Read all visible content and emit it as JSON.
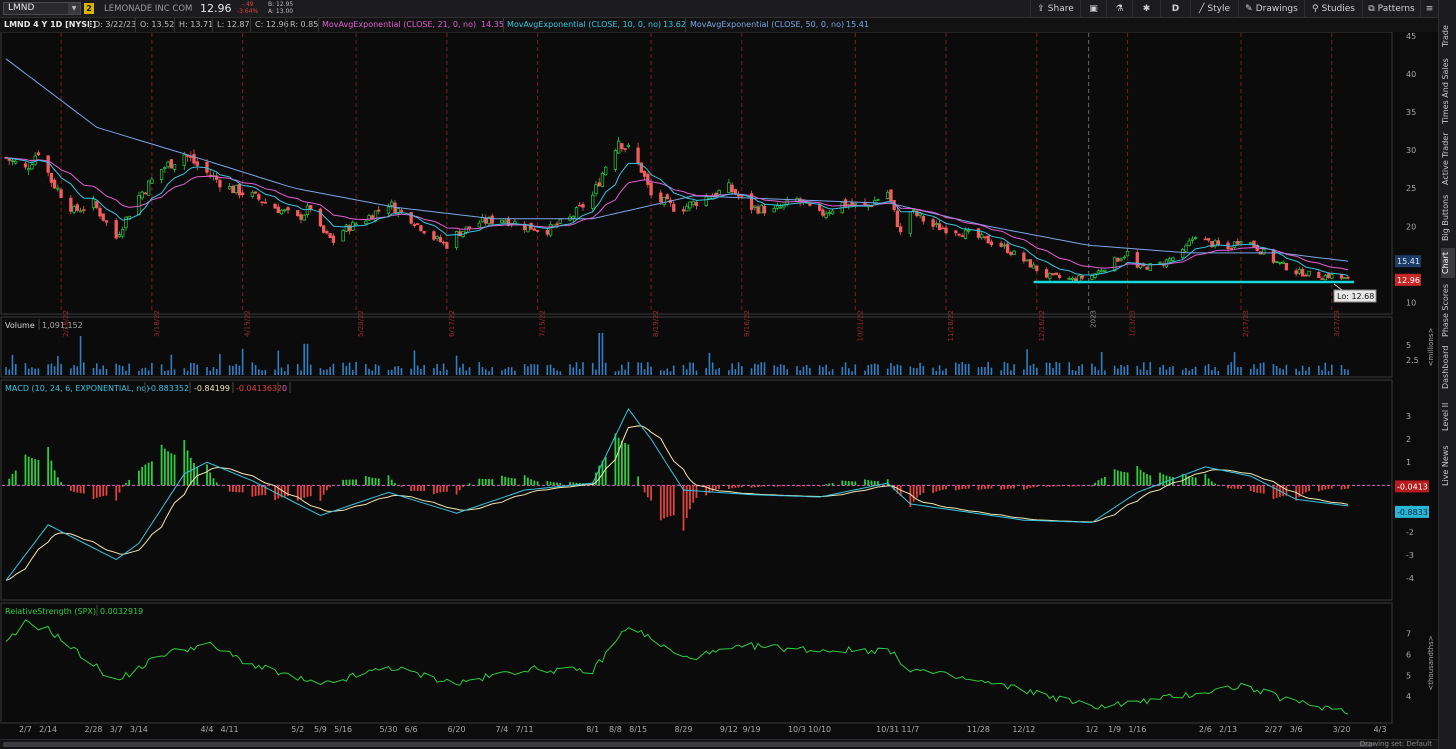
{
  "toolbar": {
    "symbol": "LMND",
    "link_number": "2",
    "company": "LEMONADE INC COM",
    "last_price": "12.96",
    "change": "-.49",
    "change_pct": "-3.64%",
    "bid": "B: 12.95",
    "ask": "A: 13.00",
    "buttons": {
      "share": "Share",
      "period": "D",
      "style": "Style",
      "drawings": "Drawings",
      "studies": "Studies",
      "patterns": "Patterns"
    },
    "icons": [
      "share-icon",
      "grid-icon",
      "flask-icon",
      "gear-icon",
      "style-icon",
      "pencil-icon",
      "studies-icon",
      "patterns-icon",
      "menu-icon"
    ]
  },
  "infobar": {
    "title": "LMND 4 Y 1D [NYSE]",
    "date": "D: 3/22/23",
    "open": "O: 13.52",
    "high": "H: 13.71",
    "low": "L: 12.87",
    "close": "C: 12.96",
    "range": "R: 0.85",
    "ma1_label": "MovAvgExponential (CLOSE, 21, 0, no)",
    "ma1_value": "14.35",
    "ma2_label": "MovAvgExponential (CLOSE, 10, 0, no)",
    "ma2_value": "13.62",
    "ma3_label": "MovAvgExponential (CLOSE, 50, 0, no)",
    "ma3_value": "15.41"
  },
  "price_panel": {
    "y_ticks": [
      "45",
      "40",
      "35",
      "30",
      "25",
      "20",
      "10"
    ],
    "low_label": "Lo: 12.68",
    "last_badge": "12.96",
    "ma50_badge": "15.41",
    "marker_dates": [
      "2/18/22",
      "3/18/22",
      "4/15/22",
      "5/20/22",
      "6/17/22",
      "7/15/22",
      "8/19/22",
      "9/16/22",
      "10/21/22",
      "11/18/22",
      "12/16/22",
      "2023",
      "1/13/23",
      "2/17/23",
      "3/17/23"
    ],
    "colors": {
      "up": "#2ecc40",
      "down": "#f25c5c",
      "ema21": "#e05fd4",
      "ema10": "#36c4e0",
      "ema50": "#7aa6e8",
      "support": "#16d8d8"
    }
  },
  "volume_panel": {
    "title": "Volume",
    "value": "1,091,152",
    "y_ticks": [
      "5",
      "2.5"
    ],
    "unit": "<millions>"
  },
  "macd_panel": {
    "title": "MACD (10, 24, 6, EXPONENTIAL, no)",
    "value": "-0.883352",
    "avg": "-0.84199",
    "diff": "-0.0413632",
    "zero": "0",
    "y_ticks": [
      "3",
      "2",
      "1",
      "-1",
      "-2",
      "-3",
      "-4"
    ],
    "badge_diff": "-0.0413",
    "badge_value": "-0.8833"
  },
  "rs_panel": {
    "title": "RelativeStrength (SPX)",
    "value": "0.0032919",
    "y_ticks": [
      "7",
      "6",
      "5",
      "4"
    ],
    "unit": "<thousandths>"
  },
  "x_axis": {
    "labels": [
      "2/7",
      "2/14",
      "2/28",
      "3/7",
      "3/14",
      "4/4",
      "4/11",
      "5/2",
      "5/9",
      "5/16",
      "5/30",
      "6/6",
      "6/20",
      "7/4",
      "7/11",
      "8/1",
      "8/8",
      "8/15",
      "8/29",
      "9/12",
      "9/19",
      "10/3",
      "10/10",
      "10/31",
      "11/7",
      "11/28",
      "12/12",
      "1/2",
      "1/9",
      "1/16",
      "2/6",
      "2/13",
      "2/27",
      "3/6",
      "3/20",
      "4/3"
    ]
  },
  "side_tabs": [
    "Trade",
    "Times And Sales",
    "Active Trader",
    "Big Buttons",
    "Chart",
    "Phase Scores",
    "Dashboard",
    "Level II",
    "Live News"
  ],
  "footer": {
    "drawing_set": "Drawing set: Default"
  },
  "chart_data": {
    "type": "candlestick",
    "symbol": "LMND",
    "interval": "1D",
    "x_start": "2/1/22",
    "x_end": "3/22/23",
    "ylim": [
      9,
      45
    ],
    "close_path": [
      [
        "2/1/22",
        29
      ],
      [
        "2/7/22",
        27.5
      ],
      [
        "2/11/22",
        30
      ],
      [
        "2/15/22",
        26
      ],
      [
        "2/22/22",
        22
      ],
      [
        "2/28/22",
        23
      ],
      [
        "3/7/22",
        18.5
      ],
      [
        "3/10/22",
        21
      ],
      [
        "3/14/22",
        24
      ],
      [
        "3/21/22",
        27.5
      ],
      [
        "3/28/22",
        29.5
      ],
      [
        "4/1/22",
        28
      ],
      [
        "4/4/22",
        27
      ],
      [
        "4/11/22",
        25
      ],
      [
        "4/18/22",
        24
      ],
      [
        "4/25/22",
        22.5
      ],
      [
        "5/2/22",
        21
      ],
      [
        "5/6/22",
        22.5
      ],
      [
        "5/9/22",
        19.5
      ],
      [
        "5/13/22",
        18
      ],
      [
        "5/16/22",
        19.5
      ],
      [
        "5/23/22",
        21
      ],
      [
        "5/30/22",
        23
      ],
      [
        "6/6/22",
        21
      ],
      [
        "6/13/22",
        18.5
      ],
      [
        "6/17/22",
        17.5
      ],
      [
        "6/20/22",
        19
      ],
      [
        "6/27/22",
        20.5
      ],
      [
        "7/4/22",
        21
      ],
      [
        "7/11/22",
        20
      ],
      [
        "7/18/22",
        19.5
      ],
      [
        "7/25/22",
        21
      ],
      [
        "8/1/22",
        24
      ],
      [
        "8/5/22",
        28
      ],
      [
        "8/9/22",
        31.5
      ],
      [
        "8/12/22",
        30
      ],
      [
        "8/16/22",
        27.5
      ],
      [
        "8/19/22",
        24
      ],
      [
        "8/26/22",
        22.5
      ],
      [
        "8/29/22",
        22.5
      ],
      [
        "9/6/22",
        24
      ],
      [
        "9/12/22",
        25
      ],
      [
        "9/19/22",
        22.5
      ],
      [
        "9/26/22",
        22
      ],
      [
        "10/3/22",
        23.5
      ],
      [
        "10/10/22",
        21.5
      ],
      [
        "10/17/22",
        23
      ],
      [
        "10/24/22",
        22.5
      ],
      [
        "10/31/22",
        24.5
      ],
      [
        "11/4/22",
        19
      ],
      [
        "11/7/22",
        22
      ],
      [
        "11/14/22",
        20
      ],
      [
        "11/21/22",
        19.5
      ],
      [
        "11/28/22",
        18.5
      ],
      [
        "12/5/22",
        17.5
      ],
      [
        "12/12/22",
        15.5
      ],
      [
        "12/19/22",
        13.5
      ],
      [
        "12/27/22",
        13
      ],
      [
        "1/2/23",
        13.5
      ],
      [
        "1/9/23",
        15.5
      ],
      [
        "1/13/23",
        16.5
      ],
      [
        "1/16/23",
        14.5
      ],
      [
        "1/23/23",
        15
      ],
      [
        "1/30/23",
        16.5
      ],
      [
        "2/3/23",
        19
      ],
      [
        "2/6/23",
        18
      ],
      [
        "2/13/23",
        17
      ],
      [
        "2/17/23",
        18.5
      ],
      [
        "2/21/23",
        17.5
      ],
      [
        "2/27/23",
        15.5
      ],
      [
        "3/6/23",
        14
      ],
      [
        "3/13/23",
        13.5
      ],
      [
        "3/17/23",
        13.5
      ],
      [
        "3/22/23",
        12.96
      ]
    ],
    "ema50_path": [
      [
        "2/1/22",
        42
      ],
      [
        "3/1/22",
        33
      ],
      [
        "4/1/22",
        29
      ],
      [
        "5/1/22",
        25
      ],
      [
        "6/1/22",
        22.5
      ],
      [
        "7/1/22",
        21
      ],
      [
        "8/1/22",
        21
      ],
      [
        "9/1/22",
        24
      ],
      [
        "10/1/22",
        23.5
      ],
      [
        "11/1/22",
        23
      ],
      [
        "12/1/22",
        20
      ],
      [
        "1/1/23",
        17.5
      ],
      [
        "2/1/23",
        16.5
      ],
      [
        "3/1/23",
        16.5
      ],
      [
        "3/22/23",
        15.41
      ]
    ],
    "support_level": 12.68,
    "macd": [
      [
        "2/1/22",
        -4.1
      ],
      [
        "2/14/22",
        -1.7
      ],
      [
        "3/7/22",
        -3.2
      ],
      [
        "3/14/22",
        -2.5
      ],
      [
        "3/28/22",
        0.5
      ],
      [
        "4/4/22",
        1.0
      ],
      [
        "4/18/22",
        0.2
      ],
      [
        "5/9/22",
        -1.3
      ],
      [
        "5/30/22",
        -0.3
      ],
      [
        "6/20/22",
        -1.2
      ],
      [
        "7/11/22",
        -0.2
      ],
      [
        "8/1/22",
        0.1
      ],
      [
        "8/12/22",
        3.3
      ],
      [
        "8/19/22",
        2.0
      ],
      [
        "8/29/22",
        -0.2
      ],
      [
        "9/19/22",
        -0.4
      ],
      [
        "10/10/22",
        -0.5
      ],
      [
        "10/31/22",
        0.1
      ],
      [
        "11/7/22",
        -0.8
      ],
      [
        "12/12/22",
        -1.5
      ],
      [
        "1/2/23",
        -1.6
      ],
      [
        "1/16/23",
        -0.3
      ],
      [
        "2/6/23",
        0.8
      ],
      [
        "2/20/23",
        0.4
      ],
      [
        "3/6/23",
        -0.6
      ],
      [
        "3/22/23",
        -0.8833
      ]
    ],
    "relative_strength_thousandths": [
      [
        "2/1/22",
        6.5
      ],
      [
        "2/7/22",
        7.5
      ],
      [
        "2/14/22",
        7.2
      ],
      [
        "2/28/22",
        5.5
      ],
      [
        "3/7/22",
        4.7
      ],
      [
        "3/21/22",
        6.0
      ],
      [
        "4/4/22",
        6.5
      ],
      [
        "4/18/22",
        5.5
      ],
      [
        "5/9/22",
        4.5
      ],
      [
        "5/30/22",
        5.4
      ],
      [
        "6/20/22",
        4.6
      ],
      [
        "7/11/22",
        5.3
      ],
      [
        "8/1/22",
        5.2
      ],
      [
        "8/12/22",
        7.4
      ],
      [
        "8/29/22",
        5.8
      ],
      [
        "9/19/22",
        6.4
      ],
      [
        "10/10/22",
        6.2
      ],
      [
        "10/31/22",
        6.2
      ],
      [
        "11/7/22",
        5.3
      ],
      [
        "12/12/22",
        4.3
      ],
      [
        "1/2/23",
        3.5
      ],
      [
        "1/16/23",
        3.7
      ],
      [
        "2/6/23",
        4.2
      ],
      [
        "2/17/23",
        4.5
      ],
      [
        "3/6/23",
        3.7
      ],
      [
        "3/22/23",
        3.3
      ]
    ]
  }
}
